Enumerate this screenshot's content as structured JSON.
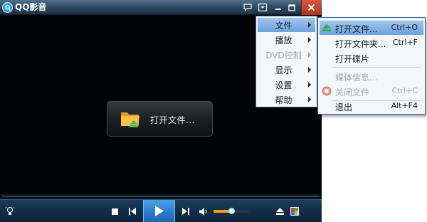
{
  "window": {
    "title": "QQ影音"
  },
  "center_panel": {
    "label": "打开文件..."
  },
  "main_menu": {
    "items": [
      {
        "label": "文件",
        "highlighted": true,
        "disabled": false
      },
      {
        "label": "播放",
        "highlighted": false,
        "disabled": false
      },
      {
        "label": "DVD控制",
        "highlighted": false,
        "disabled": true
      },
      {
        "label": "显示",
        "highlighted": false,
        "disabled": false
      },
      {
        "label": "设置",
        "highlighted": false,
        "disabled": false
      },
      {
        "label": "帮助",
        "highlighted": false,
        "disabled": false
      }
    ]
  },
  "file_submenu": {
    "items": [
      {
        "label": "打开文件...",
        "shortcut": "Ctrl+O",
        "icon": "eject-icon",
        "highlighted": true,
        "disabled": false
      },
      {
        "label": "打开文件夹...",
        "shortcut": "Ctrl+F",
        "highlighted": false,
        "disabled": false
      },
      {
        "label": "打开碟片",
        "shortcut": "",
        "highlighted": false,
        "disabled": false
      },
      {
        "label": "媒体信息...",
        "shortcut": "",
        "highlighted": false,
        "disabled": true
      },
      {
        "label": "关闭文件",
        "shortcut": "Ctrl+C",
        "icon": "close-file-icon",
        "highlighted": false,
        "disabled": true
      },
      {
        "label": "退出",
        "shortcut": "Alt+F4",
        "highlighted": false,
        "disabled": false
      }
    ]
  },
  "controls": {
    "volume_level": 0.5
  },
  "colors": {
    "accent": "#2b7dce",
    "menu_highlight": "#6da2db",
    "volume_fill": "#f3a21c",
    "close_button": "#b4301e"
  }
}
